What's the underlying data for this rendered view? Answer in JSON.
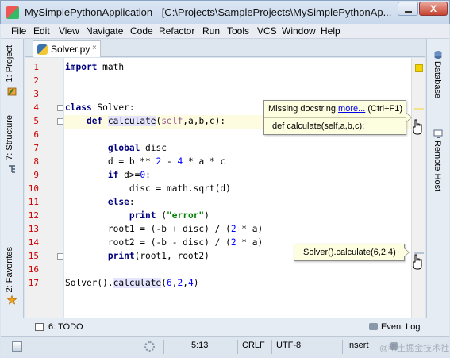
{
  "window": {
    "title": "MySimplePythonApplication - [C:\\Projects\\SampleProjects\\MySimplePythonAp...",
    "close_label": "X"
  },
  "menu": [
    "File",
    "Edit",
    "View",
    "Navigate",
    "Code",
    "Refactor",
    "Run",
    "Tools",
    "VCS",
    "Window",
    "Help"
  ],
  "left_tools": {
    "project": "1: Project",
    "structure": "7: Structure",
    "favorites": "2: Favorites"
  },
  "right_tools": {
    "database": "Database",
    "remote_host": "Remote Host"
  },
  "editor_tab": {
    "label": "Solver.py",
    "close": "×"
  },
  "code": {
    "line_numbers": [
      "1",
      "2",
      "3",
      "4",
      "5",
      "6",
      "7",
      "8",
      "9",
      "10",
      "11",
      "12",
      "13",
      "14",
      "15",
      "16",
      "17"
    ],
    "lines": [
      {
        "n": 1,
        "text": "import math"
      },
      {
        "n": 2,
        "text": ""
      },
      {
        "n": 3,
        "text": ""
      },
      {
        "n": 4,
        "text": "class Solver:"
      },
      {
        "n": 5,
        "text": "    def calculate(self,a,b,c):"
      },
      {
        "n": 6,
        "text": ""
      },
      {
        "n": 7,
        "text": ""
      },
      {
        "n": 8,
        "text": "        global disc"
      },
      {
        "n": 9,
        "text": "        d = b ** 2 - 4 * a * c"
      },
      {
        "n": 10,
        "text": "        if d>=0:"
      },
      {
        "n": 11,
        "text": "            disc = math.sqrt(d)"
      },
      {
        "n": 12,
        "text": "        else:"
      },
      {
        "n": 13,
        "text": "            print (\"error\")"
      },
      {
        "n": 14,
        "text": "        root1 = (-b + disc) / (2 * a)"
      },
      {
        "n": 15,
        "text": "        root2 = (-b - disc) / (2 * a)"
      },
      {
        "n": 16,
        "text": "        print(root1, root2)"
      },
      {
        "n": 17,
        "text": "Solver().calculate(6,2,4)"
      }
    ]
  },
  "tooltip_docstring": {
    "message": "Missing docstring ",
    "link": "more...",
    "shortcut": " (Ctrl+F1)",
    "signature": "def calculate(self,a,b,c):"
  },
  "tooltip_call": {
    "text": "Solver().calculate(6,2,4)"
  },
  "bottom_tools": {
    "todo": "6: TODO",
    "event_log": "Event Log"
  },
  "status": {
    "position": "5:13",
    "line_sep": "CRLF",
    "encoding": "UTF-8",
    "mode": "Insert",
    "watermark": "@稀土掘金技术社区"
  },
  "colors": {
    "keyword": "#000080",
    "number": "#0000ff",
    "string": "#008000",
    "line_number": "#cc0000",
    "current_line": "#fdfbe0",
    "tooltip_bg": "#fdfde0"
  }
}
